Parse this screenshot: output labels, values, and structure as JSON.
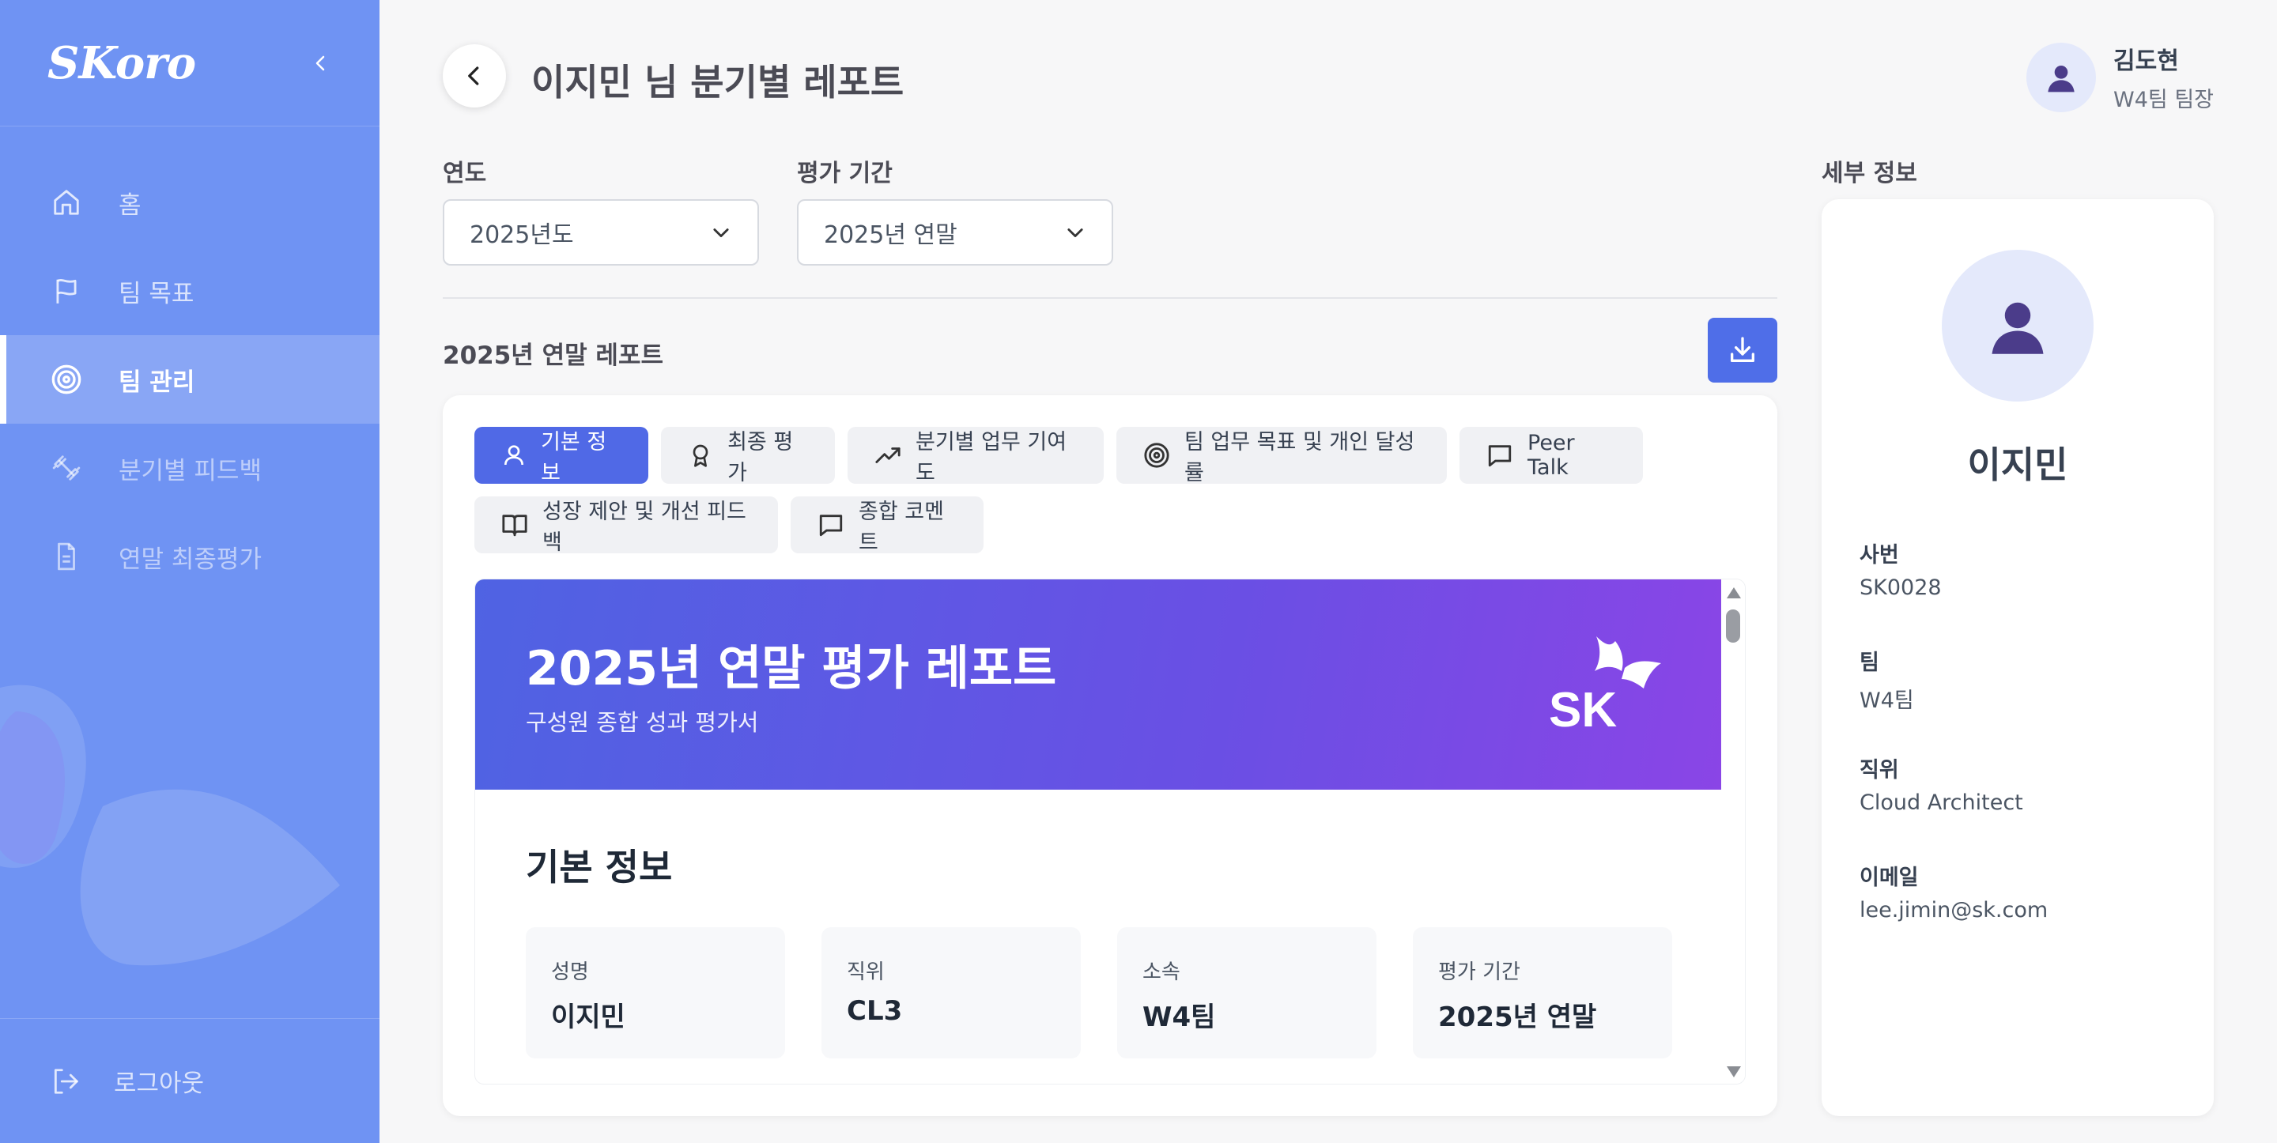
{
  "sidebar": {
    "logo": "SKoro",
    "items": [
      {
        "label": "홈",
        "icon": "home-icon"
      },
      {
        "label": "팀 목표",
        "icon": "flag-icon"
      },
      {
        "label": "팀 관리",
        "icon": "target-icon"
      },
      {
        "label": "분기별 피드백",
        "icon": "dumbbell-icon"
      },
      {
        "label": "연말 최종평가",
        "icon": "document-icon"
      }
    ],
    "logout_label": "로그아웃"
  },
  "header": {
    "title": "이지민 님 분기별 레포트",
    "user_name": "김도현",
    "user_role": "W4팀 팀장"
  },
  "filters": {
    "year_label": "연도",
    "year_value": "2025년도",
    "period_label": "평가 기간",
    "period_value": "2025년 연말"
  },
  "report": {
    "title": "2025년 연말 레포트",
    "tabs": [
      {
        "label": "기본 정보",
        "icon": "user-icon",
        "active": true
      },
      {
        "label": "최종 평가",
        "icon": "award-icon"
      },
      {
        "label": "분기별 업무 기여도",
        "icon": "trending-up-icon"
      },
      {
        "label": "팀 업무 목표 및 개인 달성률",
        "icon": "target-icon"
      },
      {
        "label": "Peer Talk",
        "icon": "message-icon"
      },
      {
        "label": "성장 제안 및 개선 피드백",
        "icon": "book-icon"
      },
      {
        "label": "종합 코멘트",
        "icon": "message-icon"
      }
    ],
    "banner_title": "2025년 연말 평가 레포트",
    "banner_subtitle": "구성원 종합 성과 평가서",
    "banner_logo_text": "SK",
    "section_title": "기본 정보",
    "info": [
      {
        "label": "성명",
        "value": "이지민"
      },
      {
        "label": "직위",
        "value": "CL3"
      },
      {
        "label": "소속",
        "value": "W4팀"
      },
      {
        "label": "평가 기간",
        "value": "2025년 연말"
      }
    ]
  },
  "detail": {
    "section_label": "세부 정보",
    "name": "이지민",
    "fields": [
      {
        "label": "사번",
        "value": "SK0028"
      },
      {
        "label": "팀",
        "value": "W4팀"
      },
      {
        "label": "직위",
        "value": "Cloud Architect"
      },
      {
        "label": "이메일",
        "value": "lee.jimin@sk.com"
      }
    ]
  },
  "colors": {
    "sidebar_bg": "#6f93f3",
    "accent": "#5069e6",
    "banner_gradient_start": "#4f63e3",
    "banner_gradient_end": "#8a45e6"
  }
}
